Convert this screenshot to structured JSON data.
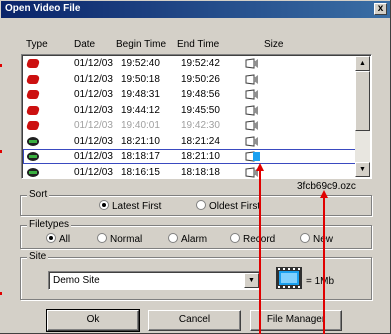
{
  "window": {
    "title": "Open Video File",
    "close_label": "x"
  },
  "columns": [
    "Type",
    "Date",
    "Begin Time",
    "End Time",
    "Size"
  ],
  "rows": [
    {
      "icon": "red-alarm-icon",
      "date": "01/12/03",
      "begin": "19:52:40",
      "end": "19:52:42",
      "dim": false,
      "selected": false
    },
    {
      "icon": "red-alarm-icon",
      "date": "01/12/03",
      "begin": "19:50:18",
      "end": "19:50:26",
      "dim": false,
      "selected": false
    },
    {
      "icon": "red-alarm-icon",
      "date": "01/12/03",
      "begin": "19:48:31",
      "end": "19:48:56",
      "dim": false,
      "selected": false
    },
    {
      "icon": "red-alarm-icon",
      "date": "01/12/03",
      "begin": "19:44:12",
      "end": "19:45:50",
      "dim": false,
      "selected": false
    },
    {
      "icon": "red-alarm-icon",
      "date": "01/12/03",
      "begin": "19:40:01",
      "end": "19:42:30",
      "dim": true,
      "selected": false
    },
    {
      "icon": "camera-icon",
      "date": "01/12/03",
      "begin": "18:21:10",
      "end": "18:21:24",
      "dim": false,
      "selected": false
    },
    {
      "icon": "camera-icon",
      "date": "01/12/03",
      "begin": "18:18:17",
      "end": "18:21:10",
      "dim": false,
      "selected": true
    },
    {
      "icon": "camera-icon",
      "date": "01/12/03",
      "begin": "18:16:15",
      "end": "18:18:18",
      "dim": false,
      "selected": false
    }
  ],
  "filename": "3fcb69c9.ozc",
  "sort": {
    "label": "Sort",
    "options": [
      "Latest First",
      "Oldest First"
    ],
    "selected": "Latest First"
  },
  "filetypes": {
    "label": "Filetypes",
    "options": [
      "All",
      "Normal",
      "Alarm",
      "Record",
      "New"
    ],
    "selected": "All"
  },
  "site": {
    "label": "Site",
    "value": "Demo Site",
    "size_label": "= 1Mb"
  },
  "buttons": {
    "ok": "Ok",
    "cancel": "Cancel",
    "file_manager": "File Manager"
  },
  "colors": {
    "title_bar": "#0a246a",
    "selection": "#3a4ac0",
    "annotation": "#e00000",
    "film_accent": "#1aa0f0"
  }
}
